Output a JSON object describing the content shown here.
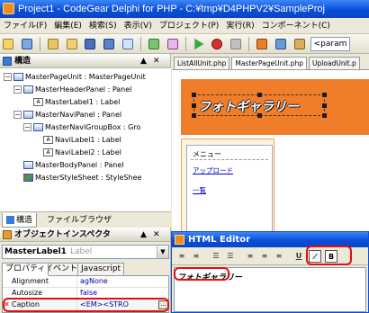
{
  "window": {
    "title": "Project1 - CodeGear Delphi for PHP - C:¥tmp¥D4PHPV2¥SampleProj"
  },
  "menu": {
    "items": [
      "ファイル(F)",
      "編集(E)",
      "検索(S)",
      "表示(V)",
      "プロジェクト(P)",
      "実行(R)",
      "コンポーネント(C)"
    ]
  },
  "toolbar": {
    "param_value": "<param"
  },
  "structure_panel": {
    "title": "構造",
    "pin": "▲",
    "close": "✕",
    "tree": [
      {
        "label": "MasterPageUnit : MasterPageUnit",
        "level": 0,
        "expander": "−",
        "kind": "container"
      },
      {
        "label": "MasterHeaderPanel : Panel",
        "level": 1,
        "expander": "−",
        "kind": "container"
      },
      {
        "label": "MasterLabel1 : Label",
        "level": 2,
        "expander": "",
        "kind": "label"
      },
      {
        "label": "MasterNaviPanel : Panel",
        "level": 1,
        "expander": "−",
        "kind": "container"
      },
      {
        "label": "MasterNaviGroupBox : Gro",
        "level": 2,
        "expander": "−",
        "kind": "container"
      },
      {
        "label": "NaviLabel1 : Label",
        "level": 3,
        "expander": "",
        "kind": "label"
      },
      {
        "label": "NaviLabel2 : Label",
        "level": 3,
        "expander": "",
        "kind": "label"
      },
      {
        "label": "MasterBodyPanel : Panel",
        "level": 1,
        "expander": "",
        "kind": "container"
      },
      {
        "label": "MasterStyleSheet : StyleShee",
        "level": 1,
        "expander": "",
        "kind": "style"
      }
    ],
    "tabs": [
      "構造",
      "ファイルブラウザ"
    ]
  },
  "inspector": {
    "title": "オブジェクトインスペクタ",
    "pin": "▲",
    "close": "✕",
    "object_name": "MasterLabel1",
    "object_type": "Label",
    "tabs": [
      "プロパティ",
      "イベント",
      "Javascript"
    ],
    "properties": [
      {
        "name": "Alignment",
        "value": "agNone"
      },
      {
        "name": "Autosize",
        "value": "false"
      },
      {
        "name": "Caption",
        "value": "<EM><STRO"
      }
    ],
    "ellipsis": "…"
  },
  "designer": {
    "tabs": [
      "ListAllUnit.php",
      "MasterPageUnit.php",
      "UploadUnit.p"
    ],
    "header_label": "フォトギャラリー",
    "menu_title": "メニュー",
    "nav_links": [
      "アップロード",
      "一覧"
    ]
  },
  "html_editor": {
    "title": "HTML Editor",
    "tools": [
      "≡",
      "≡",
      "☰",
      "☰",
      "≡",
      "≡",
      "≡",
      "U",
      "⁄",
      "B"
    ],
    "content": "フォトギャラリー"
  },
  "colors": {
    "xp_blue": "#0a4fd8",
    "header_orange": "#f07d2a",
    "annotation_red": "#e01010",
    "link_blue": "#0000cc"
  }
}
